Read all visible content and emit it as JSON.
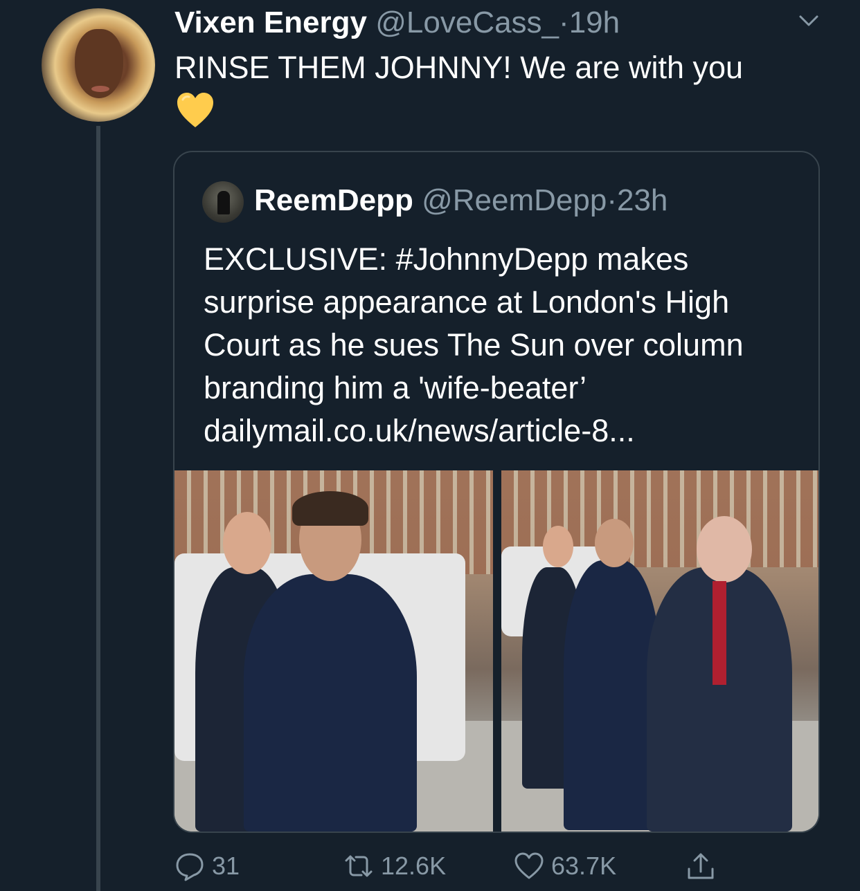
{
  "tweet": {
    "author_name": "Vixen Energy",
    "author_handle": "@LoveCass_",
    "separator": "·",
    "time": "19h",
    "text": "RINSE THEM JOHNNY! We are with you",
    "emoji": "yellow-heart"
  },
  "quoted": {
    "author_name": "ReemDepp",
    "author_handle": "@ReemDepp",
    "separator": "·",
    "time": "23h",
    "text": "EXCLUSIVE: #JohnnyDepp makes surprise appearance at London's High Court as he sues The Sun over column branding him a 'wife-beater’ dailymail.co.uk/news/article-8..."
  },
  "actions": {
    "reply_count": "31",
    "retweet_count": "12.6K",
    "like_count": "63.7K"
  },
  "colors": {
    "background": "#15202b",
    "secondary_text": "#8899a6",
    "border": "#38444d",
    "heart": "#ffcc4d"
  }
}
